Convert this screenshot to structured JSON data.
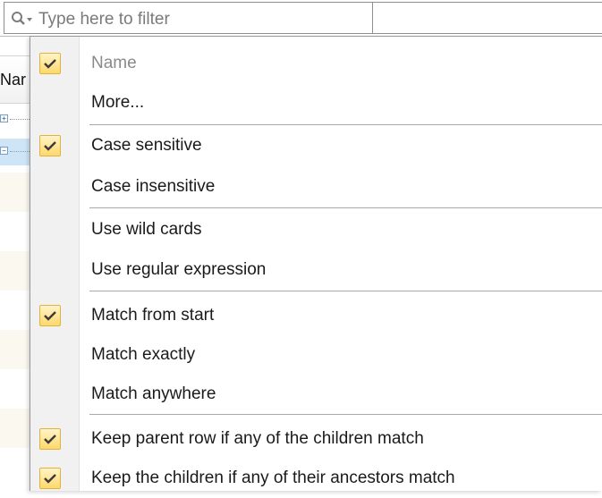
{
  "filter": {
    "placeholder": "Type here to filter"
  },
  "tree": {
    "header": "Nar",
    "rows": [
      {
        "expander": "+",
        "selected": false
      },
      {
        "expander": "−",
        "selected": true
      }
    ]
  },
  "menu": {
    "items": [
      {
        "label": "Name",
        "checked": true,
        "disabled": true
      },
      {
        "label": "More...",
        "checked": false,
        "disabled": false
      },
      {
        "label": "Case sensitive",
        "checked": true,
        "disabled": false
      },
      {
        "label": "Case insensitive",
        "checked": false,
        "disabled": false
      },
      {
        "label": "Use wild cards",
        "checked": false,
        "disabled": false
      },
      {
        "label": "Use regular expression",
        "checked": false,
        "disabled": false
      },
      {
        "label": "Match from start",
        "checked": true,
        "disabled": false
      },
      {
        "label": "Match exactly",
        "checked": false,
        "disabled": false
      },
      {
        "label": "Match anywhere",
        "checked": false,
        "disabled": false
      },
      {
        "label": "Keep parent row if any of the children match",
        "checked": true,
        "disabled": false
      },
      {
        "label": "Keep the children if any of their ancestors match",
        "checked": true,
        "disabled": false
      }
    ]
  },
  "colors": {
    "check_fill": "#ffd86b",
    "check_border": "#e0b33f",
    "selected_row": "#cde5f7",
    "gutter": "#f1f1f1"
  },
  "icons": {
    "filter": "magnifier-dropdown-icon",
    "check": "checkmark-icon"
  }
}
